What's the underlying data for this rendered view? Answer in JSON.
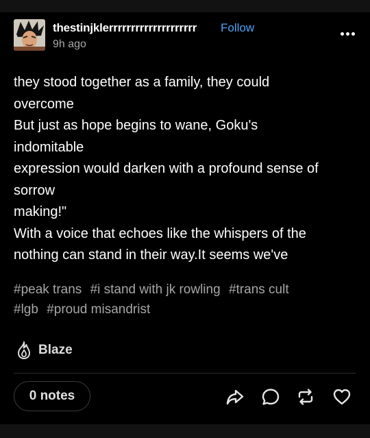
{
  "post": {
    "username": "thestinjklerrrrrrrrrrrrrrrrrrrr",
    "follow_label": "Follow",
    "time": "9h ago",
    "avatar_icon": "goku-avatar",
    "more_icon": "more-dots-icon",
    "body_lines": [
      "they stood together as a family, they could",
      "overcome",
      "But just as hope begins to wane, Goku's",
      "indomitable",
      "expression would darken with a profound sense of",
      "sorrow",
      "making!\"",
      "With a voice that echoes like the whispers of the",
      "nothing can stand in their way.It seems we've"
    ],
    "tags": [
      "#peak trans",
      "#i stand with jk rowling",
      "#trans cult",
      "#lgb",
      "#proud misandrist"
    ],
    "blaze_label": "Blaze",
    "notes_label": "0 notes",
    "actions": [
      "share-icon",
      "reply-icon",
      "reblog-icon",
      "like-icon"
    ]
  },
  "colors": {
    "background": "#000000",
    "text": "#ffffff",
    "muted": "#a7a7a7",
    "accent_link": "#4ea4f5"
  }
}
